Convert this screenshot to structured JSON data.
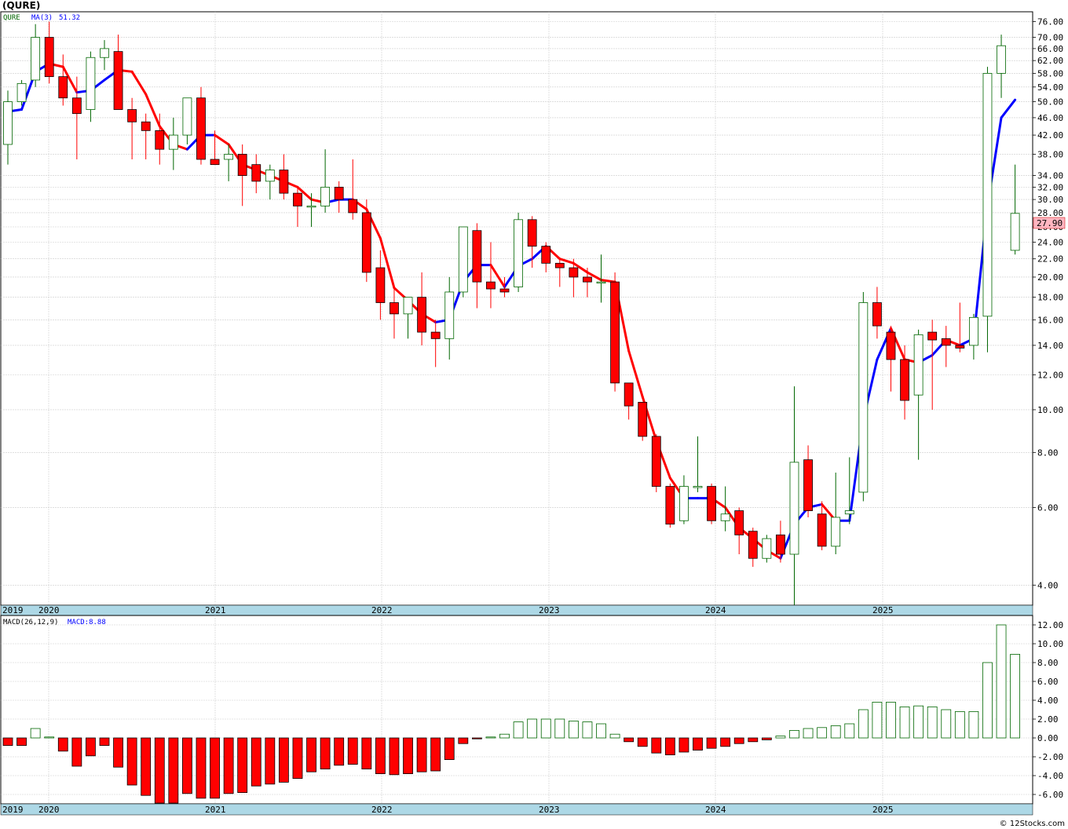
{
  "header": {
    "symbol": "(QURE)",
    "watermark": "© 12Stocks.com"
  },
  "price_panel": {
    "ticker": "QURE",
    "ma_label": "MA(3)",
    "ma_value": "51.32",
    "last_price": "27.90"
  },
  "macd_panel": {
    "label": "MACD(26,12,9)",
    "macd_label": "MACD:8.88"
  },
  "colors": {
    "up": "#006600",
    "down": "#ff0000",
    "ma_up": "#0000ff",
    "ma_down": "#ff0000",
    "axis_band": "#add8e6",
    "grid": "#cccccc",
    "last_price_box": "#ffb6c1"
  },
  "chart_data": [
    {
      "type": "candlestick",
      "title": "(QURE)",
      "scale": "log",
      "ylim": [
        3.6,
        80
      ],
      "yticks": [
        4,
        6,
        8,
        10,
        12,
        14,
        16,
        18,
        20,
        22,
        24,
        26,
        28,
        30,
        32,
        34,
        38,
        42,
        46,
        50,
        54,
        58,
        62,
        66,
        70,
        76
      ],
      "x_labels": [
        "2019",
        "2020",
        "2021",
        "2022",
        "2023",
        "2024",
        "2025"
      ],
      "candles": [
        {
          "o": 40,
          "h": 53,
          "l": 36,
          "c": 50
        },
        {
          "o": 50,
          "h": 56,
          "l": 49,
          "c": 55
        },
        {
          "o": 56,
          "h": 75,
          "l": 54,
          "c": 70
        },
        {
          "o": 70,
          "h": 76,
          "l": 55,
          "c": 57
        },
        {
          "o": 57,
          "h": 64,
          "l": 49,
          "c": 51
        },
        {
          "o": 51,
          "h": 57,
          "l": 37,
          "c": 47
        },
        {
          "o": 48,
          "h": 65,
          "l": 45,
          "c": 63
        },
        {
          "o": 63,
          "h": 69,
          "l": 59,
          "c": 66
        },
        {
          "o": 65,
          "h": 71,
          "l": 48,
          "c": 48
        },
        {
          "o": 48,
          "h": 51,
          "l": 37,
          "c": 45
        },
        {
          "o": 45,
          "h": 47,
          "l": 37,
          "c": 43
        },
        {
          "o": 43,
          "h": 47,
          "l": 36,
          "c": 39
        },
        {
          "o": 39,
          "h": 46,
          "l": 35,
          "c": 42
        },
        {
          "o": 42,
          "h": 51,
          "l": 40,
          "c": 51
        },
        {
          "o": 51,
          "h": 54,
          "l": 36,
          "c": 37
        },
        {
          "o": 37,
          "h": 43,
          "l": 36,
          "c": 36
        },
        {
          "o": 37,
          "h": 40,
          "l": 33,
          "c": 38
        },
        {
          "o": 38,
          "h": 40,
          "l": 29,
          "c": 34
        },
        {
          "o": 36,
          "h": 38,
          "l": 31,
          "c": 33
        },
        {
          "o": 33,
          "h": 36,
          "l": 30,
          "c": 35
        },
        {
          "o": 35,
          "h": 38,
          "l": 30,
          "c": 31
        },
        {
          "o": 31,
          "h": 32,
          "l": 26,
          "c": 29
        },
        {
          "o": 29,
          "h": 31,
          "l": 26,
          "c": 29
        },
        {
          "o": 29,
          "h": 39,
          "l": 28,
          "c": 32
        },
        {
          "o": 32,
          "h": 33,
          "l": 28,
          "c": 30
        },
        {
          "o": 30,
          "h": 37,
          "l": 27,
          "c": 28
        },
        {
          "o": 28,
          "h": 30,
          "l": 19.5,
          "c": 20.5
        },
        {
          "o": 21,
          "h": 23,
          "l": 16,
          "c": 17.5
        },
        {
          "o": 17.5,
          "h": 19,
          "l": 14.5,
          "c": 16.5
        },
        {
          "o": 16.5,
          "h": 18,
          "l": 14.5,
          "c": 18
        },
        {
          "o": 18,
          "h": 20.5,
          "l": 14,
          "c": 15
        },
        {
          "o": 15,
          "h": 16,
          "l": 12.5,
          "c": 14.5
        },
        {
          "o": 14.5,
          "h": 20,
          "l": 13,
          "c": 18.5
        },
        {
          "o": 18.5,
          "h": 26,
          "l": 18,
          "c": 26
        },
        {
          "o": 25.5,
          "h": 26.5,
          "l": 17,
          "c": 19.5
        },
        {
          "o": 19.5,
          "h": 24,
          "l": 17,
          "c": 18.8
        },
        {
          "o": 18.8,
          "h": 20,
          "l": 18,
          "c": 18.5
        },
        {
          "o": 19,
          "h": 28,
          "l": 18.5,
          "c": 27
        },
        {
          "o": 27,
          "h": 27.5,
          "l": 21,
          "c": 23.5
        },
        {
          "o": 23.5,
          "h": 24,
          "l": 20.5,
          "c": 21.5
        },
        {
          "o": 21.5,
          "h": 22,
          "l": 19,
          "c": 21
        },
        {
          "o": 21,
          "h": 22,
          "l": 18,
          "c": 20
        },
        {
          "o": 20,
          "h": 21,
          "l": 18,
          "c": 19.5
        },
        {
          "o": 19.5,
          "h": 22.5,
          "l": 17.5,
          "c": 19.5
        },
        {
          "o": 19.5,
          "h": 20.5,
          "l": 11,
          "c": 11.5
        },
        {
          "o": 11.5,
          "h": 11.5,
          "l": 9.5,
          "c": 10.2
        },
        {
          "o": 10.4,
          "h": 10.4,
          "l": 8.5,
          "c": 8.7
        },
        {
          "o": 8.7,
          "h": 8.8,
          "l": 6.5,
          "c": 6.7
        },
        {
          "o": 6.7,
          "h": 6.8,
          "l": 5.4,
          "c": 5.5
        },
        {
          "o": 5.6,
          "h": 7.1,
          "l": 5.5,
          "c": 6.7
        },
        {
          "o": 6.7,
          "h": 8.7,
          "l": 6.5,
          "c": 6.7
        },
        {
          "o": 6.7,
          "h": 6.8,
          "l": 5.5,
          "c": 5.6
        },
        {
          "o": 5.6,
          "h": 6.7,
          "l": 5.3,
          "c": 5.8
        },
        {
          "o": 5.9,
          "h": 6,
          "l": 4.7,
          "c": 5.2
        },
        {
          "o": 5.3,
          "h": 5.4,
          "l": 4.4,
          "c": 4.6
        },
        {
          "o": 4.6,
          "h": 5.2,
          "l": 4.5,
          "c": 5.1
        },
        {
          "o": 5.2,
          "h": 5.6,
          "l": 4.5,
          "c": 4.7
        },
        {
          "o": 4.7,
          "h": 11.3,
          "l": 3.6,
          "c": 7.6
        },
        {
          "o": 7.7,
          "h": 8.3,
          "l": 5.7,
          "c": 5.9
        },
        {
          "o": 5.8,
          "h": 6.2,
          "l": 4.8,
          "c": 4.9
        },
        {
          "o": 4.9,
          "h": 7.2,
          "l": 4.7,
          "c": 5.7
        },
        {
          "o": 5.8,
          "h": 7.8,
          "l": 5.5,
          "c": 5.9
        },
        {
          "o": 6.5,
          "h": 18.5,
          "l": 6.2,
          "c": 17.5
        },
        {
          "o": 17.5,
          "h": 19,
          "l": 14.5,
          "c": 15.5
        },
        {
          "o": 15,
          "h": 15.5,
          "l": 11,
          "c": 13
        },
        {
          "o": 13,
          "h": 14,
          "l": 9.5,
          "c": 10.5
        },
        {
          "o": 10.8,
          "h": 15.2,
          "l": 7.7,
          "c": 14.8
        },
        {
          "o": 15,
          "h": 16,
          "l": 10,
          "c": 14.4
        },
        {
          "o": 14.5,
          "h": 15.5,
          "l": 12.5,
          "c": 14
        },
        {
          "o": 14,
          "h": 17.5,
          "l": 13.5,
          "c": 13.8
        },
        {
          "o": 14,
          "h": 16.5,
          "l": 13,
          "c": 16.2
        },
        {
          "o": 16.3,
          "h": 60,
          "l": 13.5,
          "c": 58
        },
        {
          "o": 58,
          "h": 71,
          "l": 51,
          "c": 67
        },
        {
          "o": 23,
          "h": 36,
          "l": 22.5,
          "c": 27.9
        }
      ],
      "ma3": [
        47.5,
        48,
        58.5,
        61,
        60,
        52.5,
        53,
        56,
        59,
        58.5,
        52,
        44,
        40,
        39,
        42,
        42,
        40,
        36,
        35,
        34,
        33,
        32,
        30,
        29.5,
        30,
        30,
        28.5,
        24.5,
        18.9,
        17.7,
        16.5,
        15.8,
        16,
        19.5,
        21.3,
        21.3,
        19,
        21.2,
        22,
        23.5,
        22,
        21.5,
        20.5,
        19.7,
        19.5,
        13.6,
        10.7,
        8.5,
        7,
        6.3,
        6.3,
        6.3,
        6,
        5.4,
        5.1,
        4.8,
        4.6,
        5.5,
        6,
        6.1,
        5.6,
        5.6,
        9.5,
        13,
        15.3,
        13,
        12.8,
        13.3,
        14.4,
        14,
        14.5,
        29,
        46,
        50.5
      ],
      "ma_last": "51.32"
    },
    {
      "type": "bar",
      "title": "MACD(26,12,9)",
      "ylim": [
        -7,
        13
      ],
      "yticks": [
        -6,
        -4,
        -2,
        0,
        2,
        4,
        6,
        8,
        10,
        12
      ],
      "x_labels": [
        "2019",
        "2020",
        "2021",
        "2022",
        "2023",
        "2024",
        "2025"
      ],
      "values": [
        -0.8,
        -0.8,
        1,
        0.1,
        -1.4,
        -3,
        -1.9,
        -0.8,
        -3.1,
        -5,
        -6.1,
        -7,
        -7,
        -5.9,
        -6.4,
        -6.4,
        -5.9,
        -5.8,
        -5.1,
        -4.9,
        -4.7,
        -4.3,
        -3.6,
        -3.3,
        -2.9,
        -2.8,
        -3.3,
        -3.8,
        -3.9,
        -3.8,
        -3.6,
        -3.5,
        -2.3,
        -0.6,
        -0.1,
        0.1,
        0.4,
        1.7,
        2,
        2,
        2,
        1.8,
        1.7,
        1.5,
        0.4,
        -0.4,
        -0.9,
        -1.6,
        -1.8,
        -1.5,
        -1.3,
        -1.1,
        -0.9,
        -0.6,
        -0.4,
        -0.2,
        0.2,
        0.8,
        1,
        1.1,
        1.3,
        1.5,
        3,
        3.8,
        3.8,
        3.3,
        3.4,
        3.3,
        3,
        2.8,
        2.8,
        8,
        12,
        8.88
      ],
      "macd_last": "8.88"
    }
  ]
}
